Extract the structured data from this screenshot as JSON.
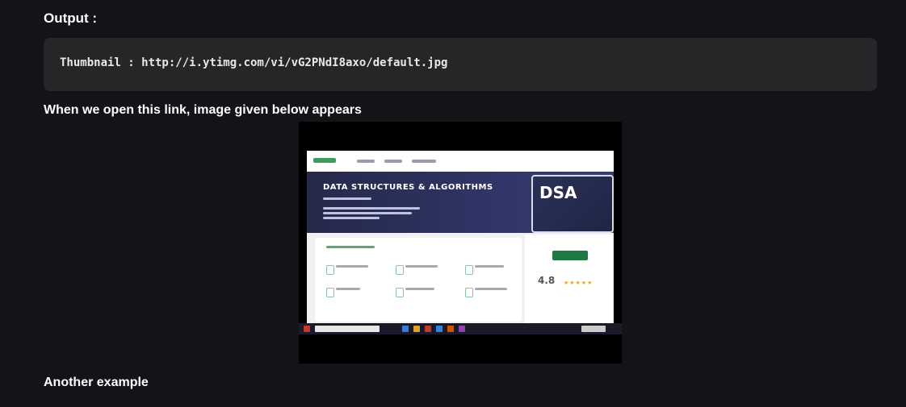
{
  "output_heading": "Output :",
  "code": {
    "text": "Thumbnail : http://i.ytimg.com/vi/vG2PNdI8axo/default.jpg"
  },
  "paragraph": "When we open this link, image given below appears",
  "thumbnail": {
    "hero_title": "DATA STRUCTURES & ALGORITHMS",
    "badge_text": "DSA",
    "rating": "4.8",
    "stars": "★★★★★",
    "colors": {
      "hero": "#2f3566",
      "accent": "#1e7a45",
      "stars": "#e7a521"
    }
  },
  "next_heading": "Another example"
}
